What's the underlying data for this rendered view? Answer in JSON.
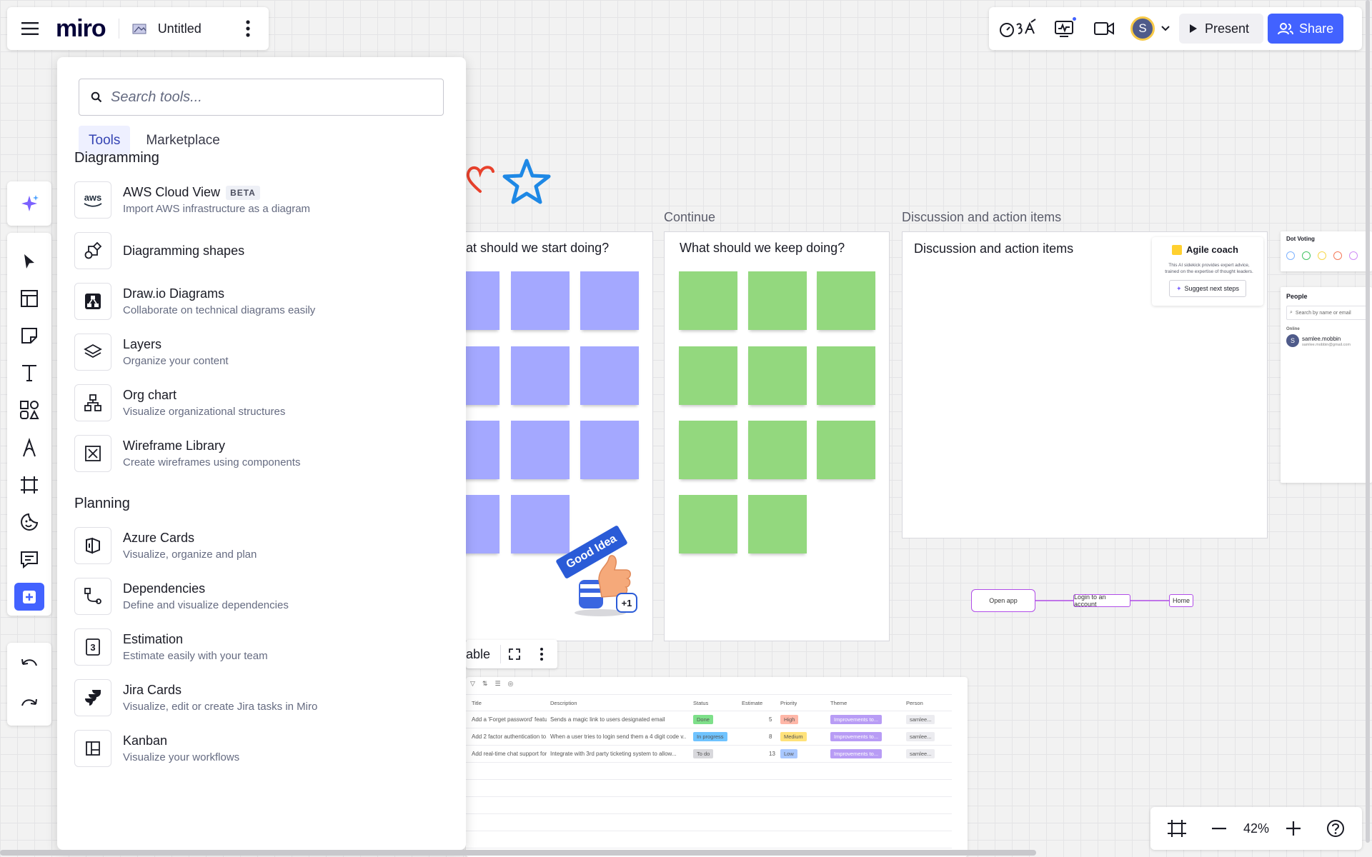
{
  "header": {
    "logo": "miro",
    "board_title": "Untitled"
  },
  "topright": {
    "present_label": "Present",
    "share_label": "Share",
    "avatar_initial": "S"
  },
  "panel": {
    "search_placeholder": "Search tools...",
    "tabs": [
      {
        "label": "Tools",
        "active": true
      },
      {
        "label": "Marketplace",
        "active": false
      }
    ],
    "sections": [
      {
        "title": "Diagramming",
        "items": [
          {
            "name": "AWS Cloud View",
            "badge": "BETA",
            "desc": "Import AWS infrastructure as a diagram",
            "icon": "aws-icon"
          },
          {
            "name": "Diagramming shapes",
            "badge": "",
            "desc": "",
            "icon": "diagram-shapes-icon"
          },
          {
            "name": "Draw.io Diagrams",
            "badge": "",
            "desc": "Collaborate on technical diagrams easily",
            "icon": "drawio-icon"
          },
          {
            "name": "Layers",
            "badge": "",
            "desc": "Organize your content",
            "icon": "layers-icon"
          },
          {
            "name": "Org chart",
            "badge": "",
            "desc": "Visualize organizational structures",
            "icon": "org-chart-icon"
          },
          {
            "name": "Wireframe Library",
            "badge": "",
            "desc": "Create wireframes using components",
            "icon": "wireframe-icon"
          }
        ]
      },
      {
        "title": "Planning",
        "items": [
          {
            "name": "Azure Cards",
            "badge": "",
            "desc": "Visualize, organize and plan",
            "icon": "azure-icon"
          },
          {
            "name": "Dependencies",
            "badge": "",
            "desc": "Define and visualize dependencies",
            "icon": "dependencies-icon"
          },
          {
            "name": "Estimation",
            "badge": "",
            "desc": "Estimate easily with your team",
            "icon": "estimation-icon"
          },
          {
            "name": "Jira Cards",
            "badge": "",
            "desc": "Visualize, edit or create Jira tasks in Miro",
            "icon": "jira-icon"
          },
          {
            "name": "Kanban",
            "badge": "",
            "desc": "Visualize your workflows",
            "icon": "kanban-icon"
          }
        ]
      }
    ]
  },
  "canvas": {
    "start_question": "at should we start doing?",
    "continue_label": "Continue",
    "keep_question": "What should we keep doing?",
    "discussion_label": "Discussion and action items",
    "discussion_title": "Discussion and action items",
    "agile_coach": {
      "title": "Agile coach",
      "line1": "This AI sidekick provides expert advice,",
      "line2": "trained on the expertise of thought leaders.",
      "button": "Suggest next steps"
    },
    "dot_voting": "Dot Voting",
    "dot_colors": [
      "#7fb3ff",
      "#43c463",
      "#f7d74a",
      "#f57a5a",
      "#d08cf5"
    ],
    "people": {
      "title": "People",
      "search": "Search by name or email",
      "online": "Online",
      "user_name": "samlee.mobbin",
      "user_email": "samlee.mobbin@gmail.com",
      "user_initial": "S"
    },
    "sticker_text": "Good Idea",
    "sticker_count": "+1",
    "flow": [
      "Open app",
      "Login to an account",
      "Home"
    ],
    "table_label": "able",
    "table": {
      "columns": [
        "Title",
        "Description",
        "Status",
        "Estimate",
        "Priority",
        "Theme",
        "Person"
      ],
      "rows": [
        {
          "title": "Add a 'Forget password' featur...",
          "desc": "Sends a magic link to users designated email",
          "status": "Done",
          "status_color": "#7ee08a",
          "estimate": "5",
          "priority": "High",
          "priority_color": "#ffb7a8",
          "theme": "Improvements to...",
          "person": "samlee..."
        },
        {
          "title": "Add 2 factor authentication to...",
          "desc": "When a user tries to login send them a 4 digit code v...",
          "status": "In progress",
          "status_color": "#6fc3ff",
          "estimate": "8",
          "priority": "Medium",
          "priority_color": "#ffe27a",
          "theme": "Improvements to...",
          "person": "samlee..."
        },
        {
          "title": "Add real-time chat support for...",
          "desc": "Integrate with 3rd party ticketing system to allow...",
          "status": "To do",
          "status_color": "#d8d8dc",
          "estimate": "13",
          "priority": "Low",
          "priority_color": "#a9c8ff",
          "theme": "Improvements to...",
          "person": "samlee..."
        }
      ]
    }
  },
  "zoom": {
    "level": "42%"
  },
  "colors": {
    "accent": "#4262ff",
    "sticky_blue": "#a4a8ff",
    "sticky_green": "#93d87e",
    "theme_purple": "#b89cf5"
  }
}
